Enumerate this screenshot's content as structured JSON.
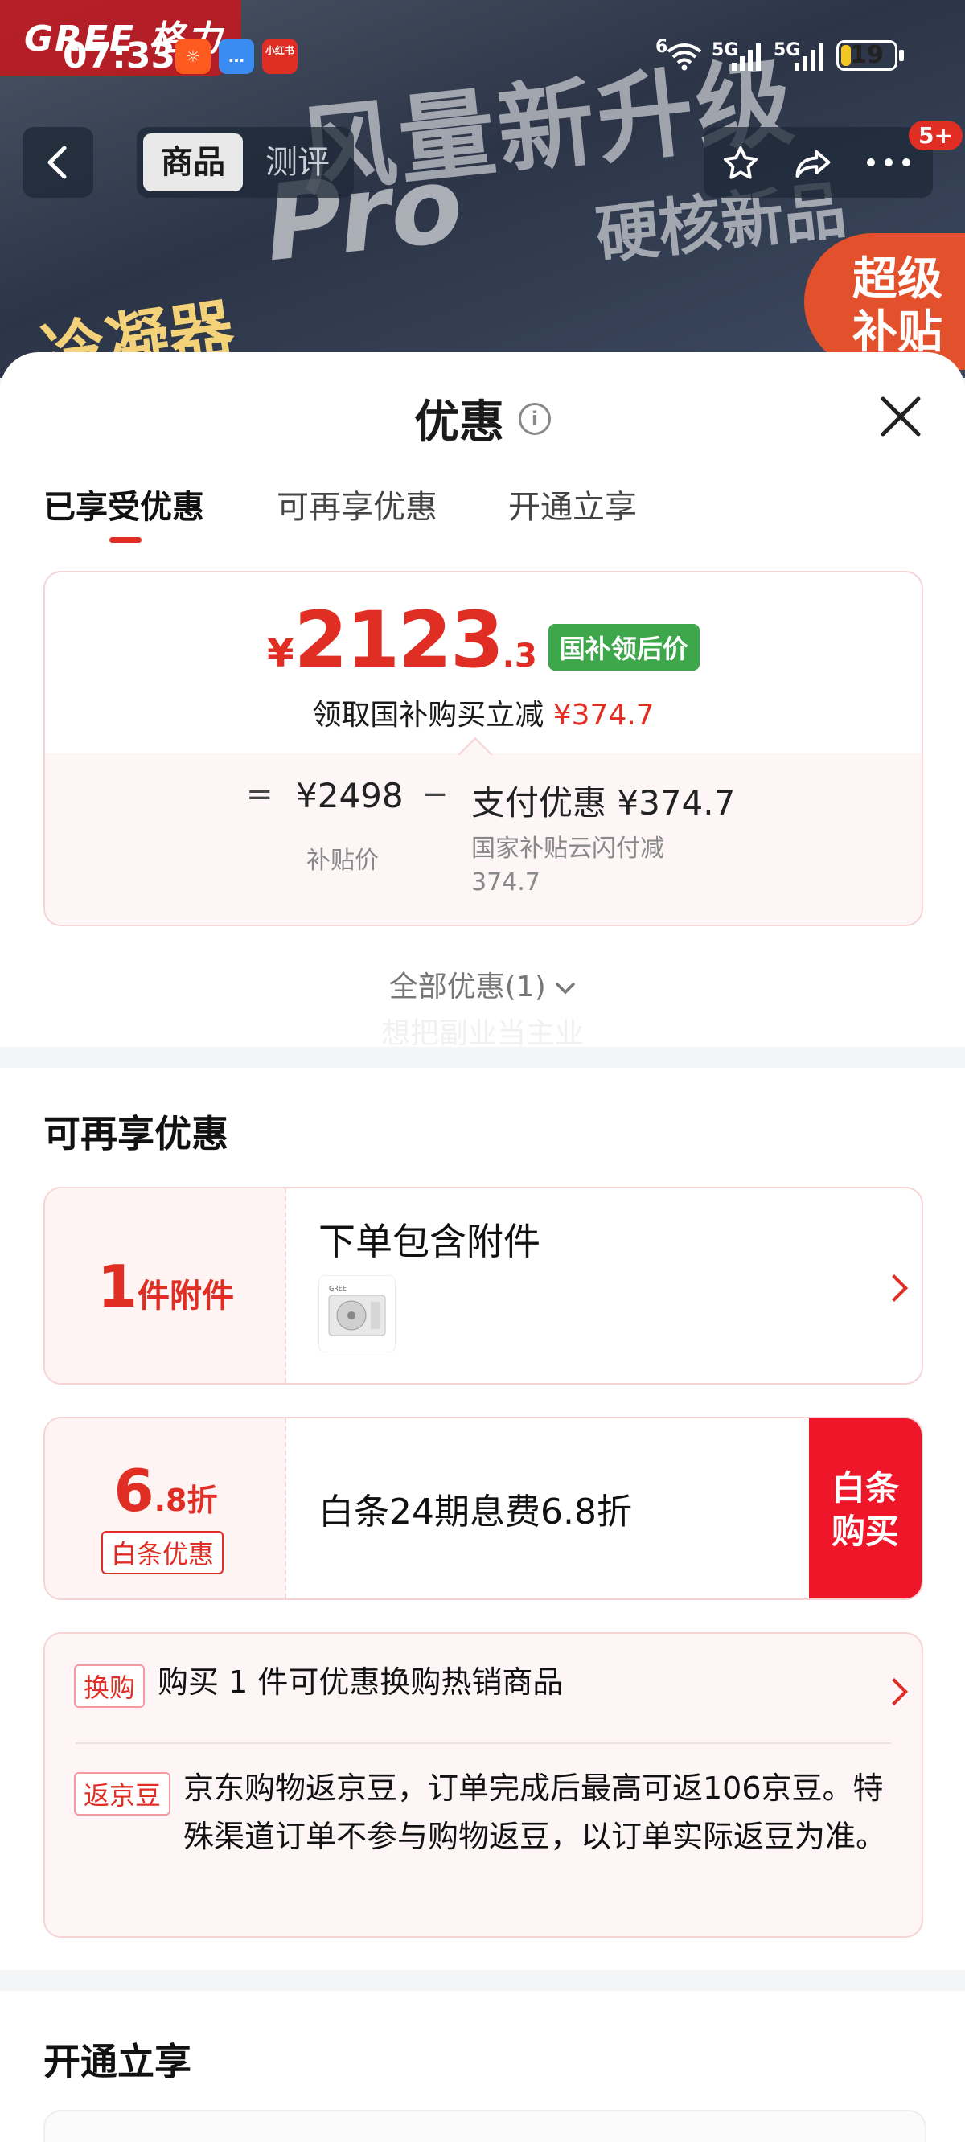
{
  "status": {
    "time": "07:33",
    "app_icons": [
      {
        "name": "taobao-app-icon",
        "color": "#ff5a1f",
        "glyph": "☼"
      },
      {
        "name": "message-app-icon",
        "color": "#3a8bf2",
        "glyph": "…"
      },
      {
        "name": "xiaohongshu-app-icon",
        "color": "#e02e24",
        "glyph": "小红书"
      }
    ],
    "network_1": "5G",
    "network_2": "5G",
    "wifi_label": "6",
    "battery": "19",
    "battery_level": 0.19
  },
  "banner": {
    "brand": "GREE 格力",
    "line1": "风量新升级",
    "line2": "Pro",
    "line3": "硬核新品",
    "badge": "超级\n补贴",
    "left_text": "冷凝器"
  },
  "nav": {
    "tab_active": "商品",
    "tab_inactive": "测评",
    "cart_badge": "5+"
  },
  "sheet": {
    "title": "优惠",
    "tabs": [
      "已享受优惠",
      "可再享优惠",
      "开通立享"
    ],
    "price": {
      "currency": "¥",
      "integer": "2123",
      "decimal": ".3",
      "tag": "国补领后价",
      "subtitle": "领取国补购买立减",
      "subtitle_amount": "¥374.7",
      "eq": "=",
      "base_value": "¥2498",
      "base_caption": "补贴价",
      "minus": "−",
      "discount_label": "支付优惠 ¥374.7",
      "discount_caption": "国家补贴云闪付减374.7"
    },
    "all_offers": "全部优惠(1)",
    "watermark": "想把副业当主业"
  },
  "more_offers": {
    "title": "可再享优惠",
    "accessory": {
      "count": "1",
      "unit": "件附件",
      "title": "下单包含附件"
    },
    "baitiao": {
      "value": "6",
      "value_dec": ".8折",
      "tag": "白条优惠",
      "title": "白条24期息费6.8折",
      "button": "白条\n购买"
    },
    "exchange": {
      "tag": "换购",
      "text": "购买 1 件可优惠换购热销商品"
    },
    "jingdou": {
      "tag": "返京豆",
      "text": "京东购物返京豆，订单完成后最高可返106京豆。特殊渠道订单不参与购物返豆，以订单实际返豆为准。"
    }
  },
  "open_section": {
    "title": "开通立享"
  }
}
